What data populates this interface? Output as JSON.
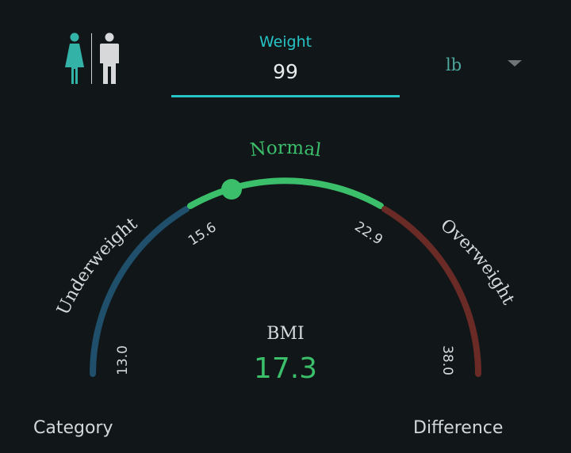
{
  "weight": {
    "label": "Weight",
    "value": "99"
  },
  "unit": {
    "selected": "lb"
  },
  "gauge": {
    "range_label": "Normal",
    "ticks": [
      "13.0",
      "15.6",
      "22.9",
      "38.0"
    ],
    "segments": [
      {
        "label": "Underweight",
        "color": "#1f4f6a"
      },
      {
        "label": "Normal",
        "color": "#3bbf6a"
      },
      {
        "label": "Overweight",
        "color": "#6a2a26"
      }
    ]
  },
  "bmi": {
    "label": "BMI",
    "value": "17.3"
  },
  "tabs": {
    "category": "Category",
    "difference": "Difference"
  },
  "icons": {
    "female": "female-person-icon",
    "male": "male-person-icon",
    "caret": "caret-down-icon"
  },
  "colors": {
    "accent": "#27c4c6",
    "normal": "#3bbf6a",
    "under": "#1f4f6a",
    "over": "#6a2a26",
    "background": "#111719"
  }
}
